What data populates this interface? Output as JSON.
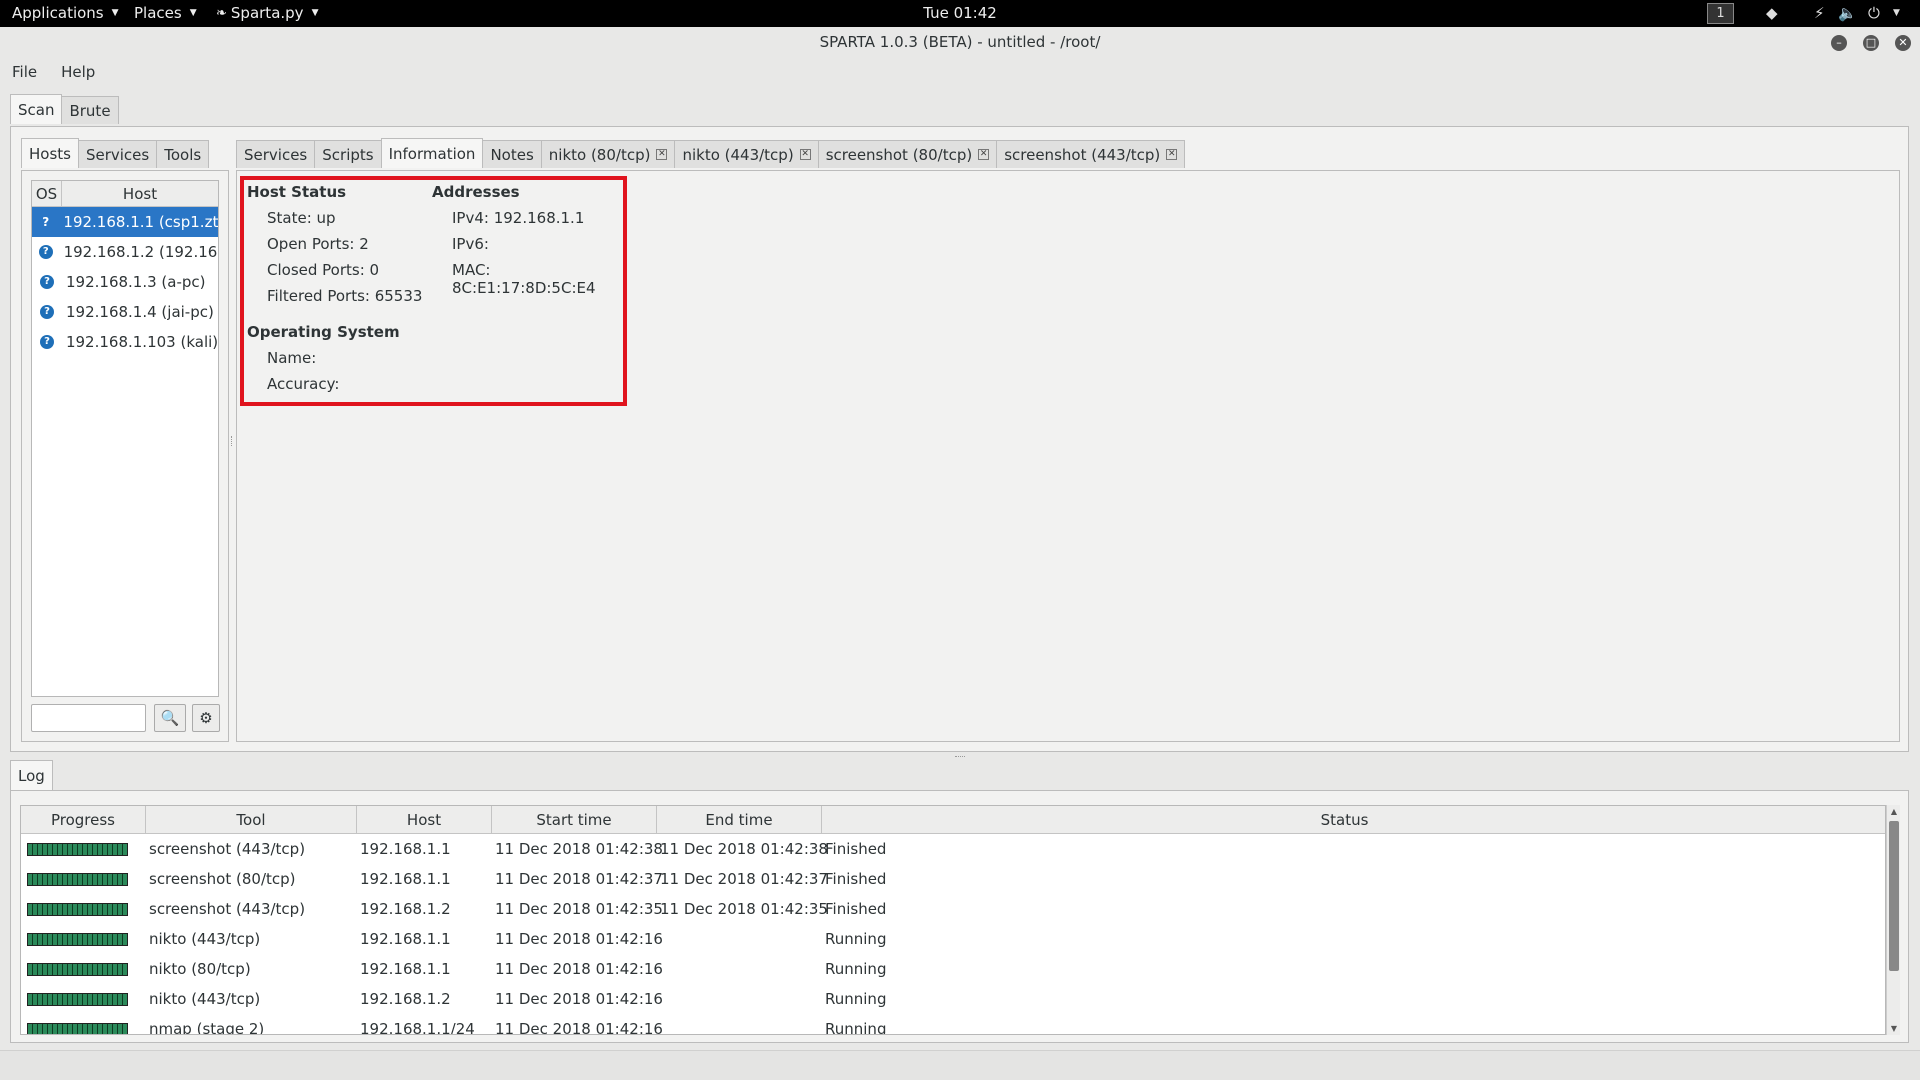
{
  "topbar": {
    "applications": "Applications",
    "places": "Places",
    "app": "Sparta.py",
    "clock": "Tue 01:42",
    "workspace": "1"
  },
  "window": {
    "title": "SPARTA 1.0.3 (BETA) - untitled - /root/"
  },
  "menubar": {
    "file": "File",
    "help": "Help"
  },
  "main_tabs": [
    "Scan",
    "Brute"
  ],
  "left_tabs": [
    "Hosts",
    "Services",
    "Tools"
  ],
  "hosts": {
    "col_os": "OS",
    "col_host": "Host",
    "rows": [
      {
        "os": "?",
        "host": "192.168.1.1 (csp1.zt..."
      },
      {
        "os": "?",
        "host": "192.168.1.2 (192.16..."
      },
      {
        "os": "?",
        "host": "192.168.1.3 (a-pc)"
      },
      {
        "os": "?",
        "host": "192.168.1.4 (jai-pc)"
      },
      {
        "os": "?",
        "host": "192.168.1.103 (kali)"
      }
    ]
  },
  "right_tabs": [
    "Services",
    "Scripts",
    "Information",
    "Notes",
    "nikto (80/tcp)",
    "nikto (443/tcp)",
    "screenshot (80/tcp)",
    "screenshot (443/tcp)"
  ],
  "info": {
    "host_status_h": "Host Status",
    "state": "State:  up",
    "open_ports": "Open Ports:  2",
    "closed_ports": "Closed Ports:  0",
    "filtered_ports": "Filtered Ports:  65533",
    "addresses_h": "Addresses",
    "ipv4": "IPv4:  192.168.1.1",
    "ipv6": "IPv6:",
    "mac": "MAC:  8C:E1:17:8D:5C:E4",
    "os_h": "Operating System",
    "name": "Name:",
    "accuracy": "Accuracy:"
  },
  "log": {
    "tab": "Log",
    "headers": [
      "Progress",
      "Tool",
      "Host",
      "Start time",
      "End time",
      "Status"
    ],
    "rows": [
      {
        "tool": "screenshot (443/tcp)",
        "host": "192.168.1.1",
        "start": "11 Dec 2018 01:42:38",
        "end": "11 Dec 2018 01:42:38",
        "status": "Finished"
      },
      {
        "tool": "screenshot (80/tcp)",
        "host": "192.168.1.1",
        "start": "11 Dec 2018 01:42:37",
        "end": "11 Dec 2018 01:42:37",
        "status": "Finished"
      },
      {
        "tool": "screenshot (443/tcp)",
        "host": "192.168.1.2",
        "start": "11 Dec 2018 01:42:35",
        "end": "11 Dec 2018 01:42:35",
        "status": "Finished"
      },
      {
        "tool": "nikto (443/tcp)",
        "host": "192.168.1.1",
        "start": "11 Dec 2018 01:42:16",
        "end": "",
        "status": "Running"
      },
      {
        "tool": "nikto (80/tcp)",
        "host": "192.168.1.1",
        "start": "11 Dec 2018 01:42:16",
        "end": "",
        "status": "Running"
      },
      {
        "tool": "nikto (443/tcp)",
        "host": "192.168.1.2",
        "start": "11 Dec 2018 01:42:16",
        "end": "",
        "status": "Running"
      },
      {
        "tool": "nmap (stage 2)",
        "host": "192.168.1.1/24",
        "start": "11 Dec 2018 01:42:16",
        "end": "",
        "status": "Running"
      }
    ]
  },
  "colors": {
    "selection": "#2a76c6",
    "highlight_border": "#e0141e",
    "progress": "#2b8a5a"
  }
}
